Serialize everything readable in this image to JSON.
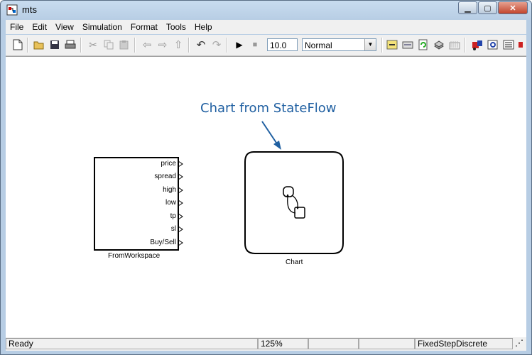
{
  "window": {
    "title": "mts"
  },
  "menu": [
    "File",
    "Edit",
    "View",
    "Simulation",
    "Format",
    "Tools",
    "Help"
  ],
  "toolbar": {
    "stop_time": "10.0",
    "sim_mode": "Normal"
  },
  "annotation": "Chart from StateFlow",
  "blocks": {
    "from_workspace": {
      "label": "FromWorkspace",
      "ports": [
        "price",
        "spread",
        "high",
        "low",
        "tp",
        "sl",
        "Buy/Sell"
      ]
    },
    "chart": {
      "label": "Chart"
    }
  },
  "status": {
    "ready": "Ready",
    "zoom": "125%",
    "solver": "FixedStepDiscrete"
  },
  "colors": {
    "annotation": "#1f5fa1",
    "titlebar": "#b9d1ea"
  }
}
